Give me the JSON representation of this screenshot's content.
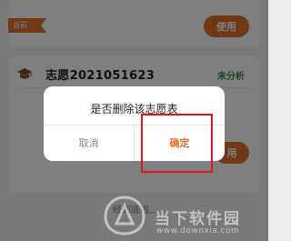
{
  "current_tag": "当前",
  "use_button_1": "使用",
  "use_button_2": "用",
  "volunteer": {
    "title": "志愿2021051623",
    "status": "未分析",
    "icon": "graduation-cap-icon"
  },
  "loading_text": "经到底啦...",
  "dialog": {
    "message": "是否删除该志愿表",
    "cancel_label": "取消",
    "confirm_label": "确定"
  },
  "watermark": {
    "name": "当下软件园",
    "url": "www.downxia.com"
  },
  "colors": {
    "accent": "#e2712c",
    "status_green": "#3a8a3a",
    "highlight_red": "#e3121b"
  }
}
